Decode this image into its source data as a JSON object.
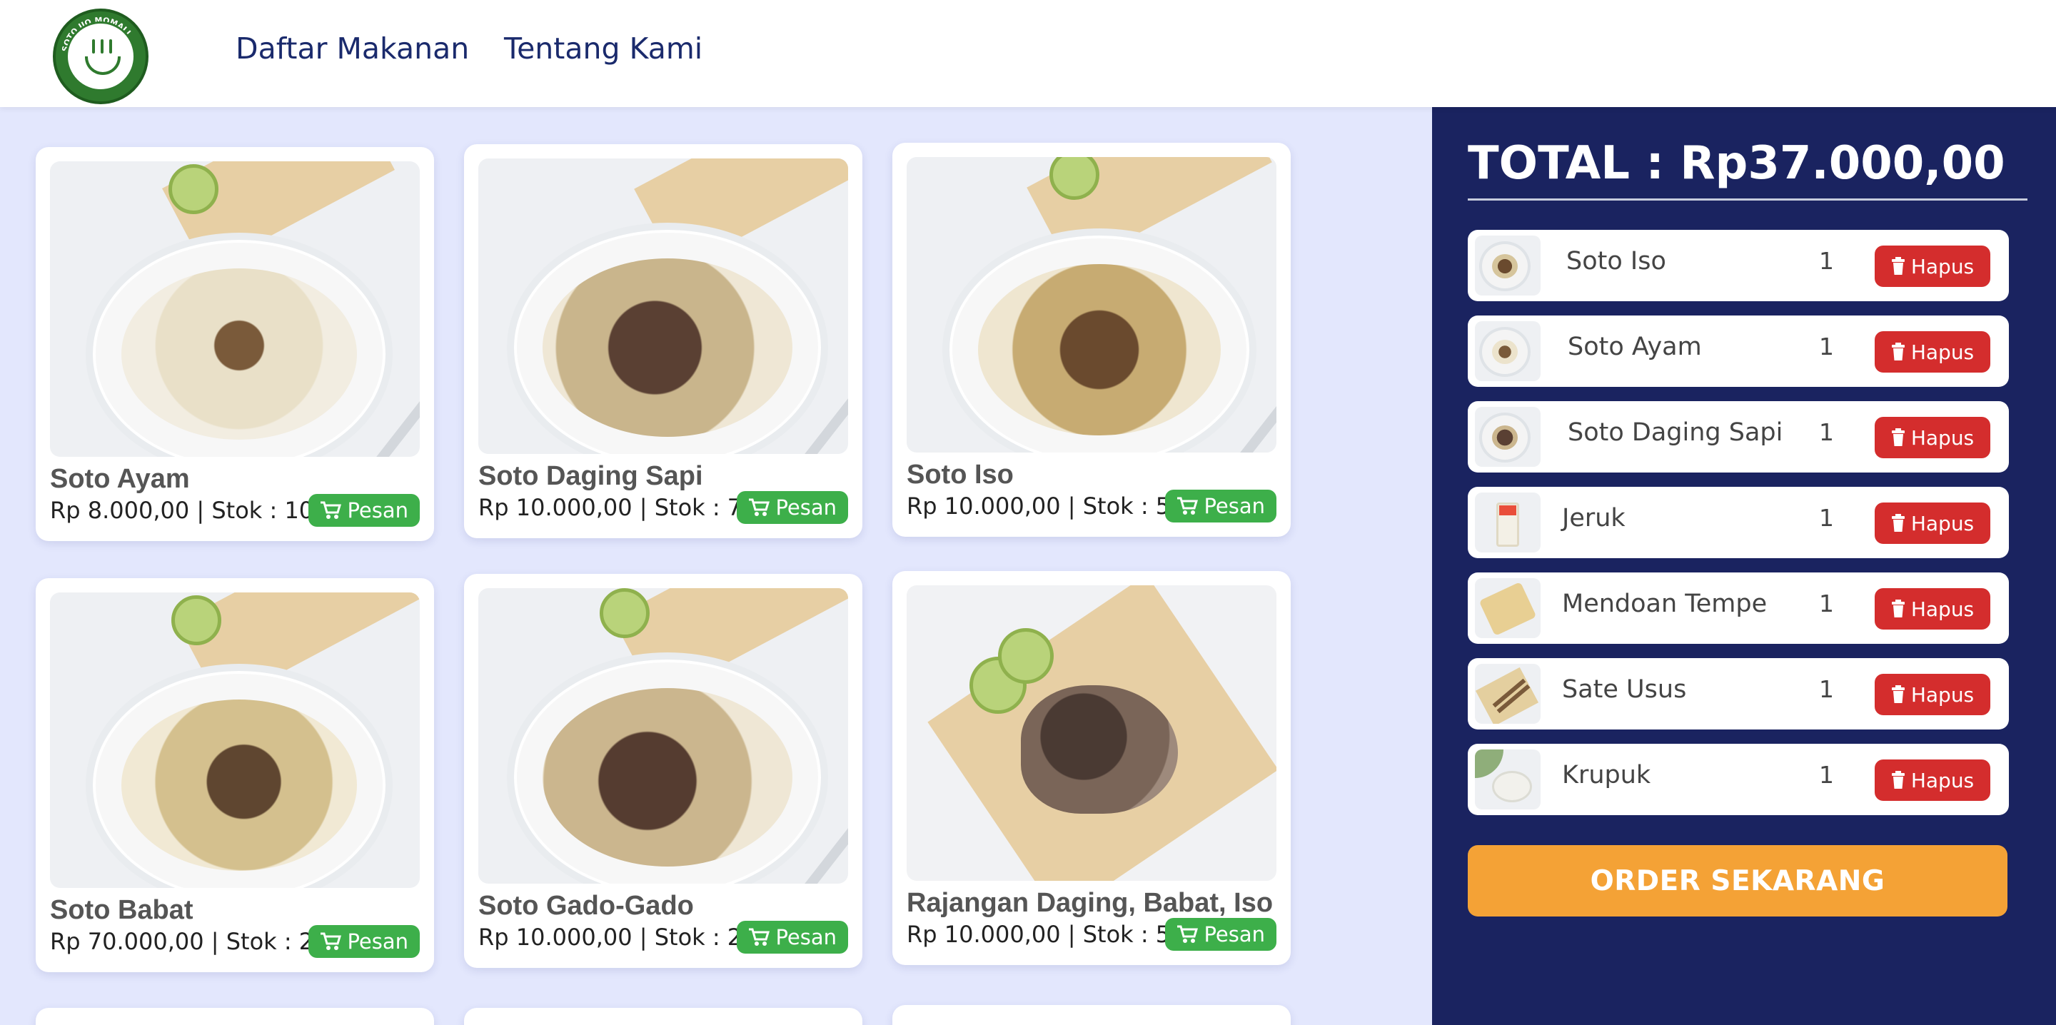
{
  "header": {
    "logo_text": "SOTO IJO MOMALI",
    "nav": [
      "Daftar Makanan",
      "Tentang Kami"
    ]
  },
  "colors": {
    "header_bg": "#ffffff",
    "nav_text": "#1a2a6c",
    "page_bg": "#e3e7fd",
    "panel_bg": "#1a2360",
    "pesan_button": "#3daf4a",
    "hapus_button": "#d42d2d",
    "order_button": "#f4a236"
  },
  "menu": {
    "pesan_label": "Pesan",
    "items": [
      {
        "name": "Soto Ayam",
        "info": "Rp 8.000,00 | Stok : 100",
        "image": "soto-ayam-photo"
      },
      {
        "name": "Soto Daging Sapi",
        "info": "Rp 10.000,00 | Stok : 70",
        "image": "soto-daging-sapi-photo"
      },
      {
        "name": "Soto Iso",
        "info": "Rp 10.000,00 | Stok : 50",
        "image": "soto-iso-photo"
      },
      {
        "name": "Soto Babat",
        "info": "Rp 70.000,00 | Stok : 20",
        "image": "soto-babat-photo"
      },
      {
        "name": "Soto Gado-Gado",
        "info": "Rp 10.000,00 | Stok : 25",
        "image": "soto-gado-gado-photo"
      },
      {
        "name": "Rajangan Daging, Babat, Iso",
        "info": "Rp 10.000,00 | Stok : 50",
        "image": "rajangan-photo"
      }
    ]
  },
  "cart": {
    "total_label": "TOTAL : Rp37.000,00",
    "hapus_label": "Hapus",
    "order_label": "ORDER SEKARANG",
    "items": [
      {
        "name": "Soto Iso",
        "qty": "1"
      },
      {
        "name": "Soto Ayam",
        "qty": "1"
      },
      {
        "name": "Soto Daging Sapi",
        "qty": "1"
      },
      {
        "name": "Jeruk",
        "qty": "1"
      },
      {
        "name": "Mendoan Tempe",
        "qty": "1"
      },
      {
        "name": "Sate Usus",
        "qty": "1"
      },
      {
        "name": "Krupuk",
        "qty": "1"
      }
    ]
  }
}
